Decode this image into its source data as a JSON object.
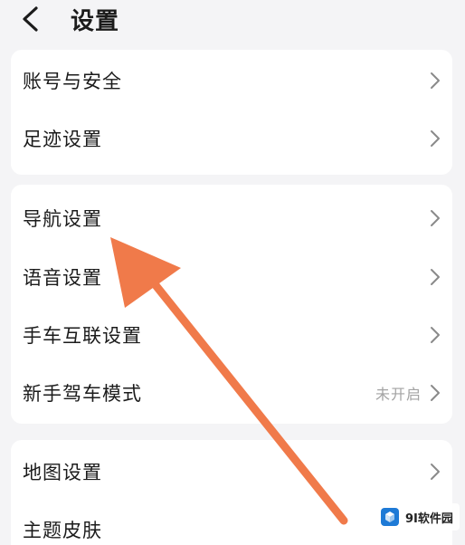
{
  "header": {
    "back_icon": "chevron-left-icon",
    "title": "设置"
  },
  "groups": [
    {
      "items": [
        {
          "label": "账号与安全",
          "icon": "chevron-right-icon"
        },
        {
          "label": "足迹设置",
          "icon": "chevron-right-icon"
        }
      ]
    },
    {
      "items": [
        {
          "label": "导航设置",
          "icon": "chevron-right-icon"
        },
        {
          "label": "语音设置",
          "icon": "chevron-right-icon"
        },
        {
          "label": "手车互联设置",
          "icon": "chevron-right-icon"
        },
        {
          "label": "新手驾车模式",
          "status": "未开启",
          "icon": "chevron-right-icon"
        }
      ]
    },
    {
      "items": [
        {
          "label": "地图设置",
          "icon": "chevron-right-icon"
        },
        {
          "label": "主题皮肤"
        }
      ]
    }
  ],
  "annotation": {
    "type": "pointer-arrow",
    "color": "#f07a4a",
    "target": "导航设置"
  },
  "watermark": {
    "text": "9I软件园",
    "logo_color": "#1e7ad6"
  },
  "colors": {
    "background": "#f4f4f6",
    "card": "#ffffff",
    "text": "#1b1b1b",
    "chevron": "#8a8a8a",
    "status": "#a3a3a3"
  }
}
